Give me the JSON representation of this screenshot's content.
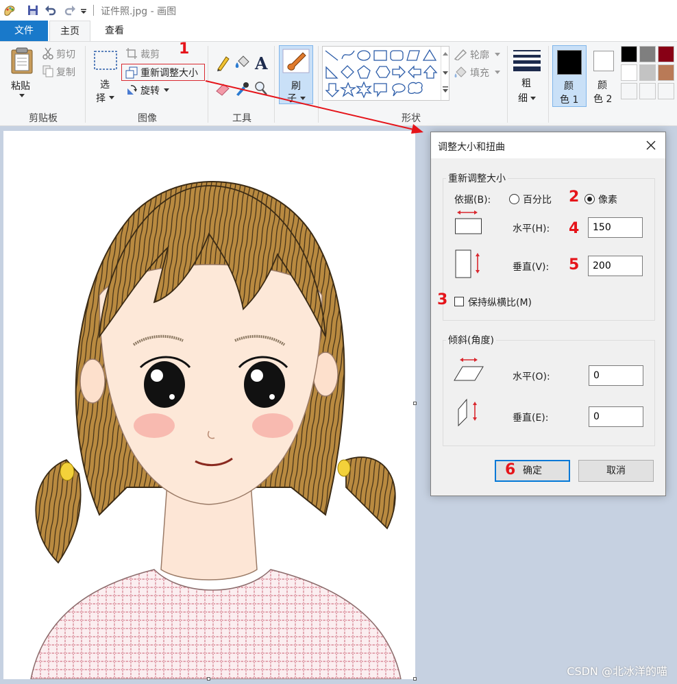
{
  "window": {
    "title": "证件照.jpg - 画图"
  },
  "tabs": [
    {
      "label": "文件"
    },
    {
      "label": "主页"
    },
    {
      "label": "查看"
    }
  ],
  "ribbon": {
    "clipboard": {
      "group_label": "剪贴板",
      "paste": "粘贴",
      "cut": "剪切",
      "copy": "复制"
    },
    "image": {
      "group_label": "图像",
      "select_line1": "选",
      "select_line2": "择",
      "crop": "裁剪",
      "resize": "重新调整大小",
      "rotate": "旋转"
    },
    "tools": {
      "group_label": "工具"
    },
    "brushes": {
      "line1": "刷",
      "line2": "子"
    },
    "shapes": {
      "group_label": "形状",
      "outline": "轮廓",
      "fill": "填充"
    },
    "size": {
      "line1": "粗",
      "line2": "细"
    },
    "color1": {
      "line1": "颜",
      "line2": "色 1"
    },
    "color2": {
      "line1": "颜",
      "line2": "色 2"
    },
    "palette": [
      "#000000",
      "#7f7f7f",
      "#880015",
      "#ffffff",
      "#c3c3c3",
      "#b97a57",
      "",
      "",
      ""
    ]
  },
  "dialog": {
    "title": "调整大小和扭曲",
    "resize_section": "重新调整大小",
    "by_label": "依据(B):",
    "percent_label": "百分比",
    "pixels_label": "像素",
    "horizontal_label": "水平(H):",
    "horizontal_value": "150",
    "vertical_label": "垂直(V):",
    "vertical_value": "200",
    "keep_ratio_label": "保持纵横比(M)",
    "keep_ratio_checked": false,
    "skew_section": "倾斜(角度)",
    "skew_h_label": "水平(O):",
    "skew_h_value": "0",
    "skew_v_label": "垂直(E):",
    "skew_v_value": "0",
    "ok_label": "确定",
    "cancel_label": "取消"
  },
  "annotations": [
    "1",
    "2",
    "3",
    "4",
    "5",
    "6"
  ],
  "watermark": "CSDN @北冰洋的喵",
  "colors": {
    "accent": "#1979ca",
    "annotation": "#e5141a",
    "hair": "#b88a3e",
    "canvas_bg": "#c6d1e1"
  }
}
